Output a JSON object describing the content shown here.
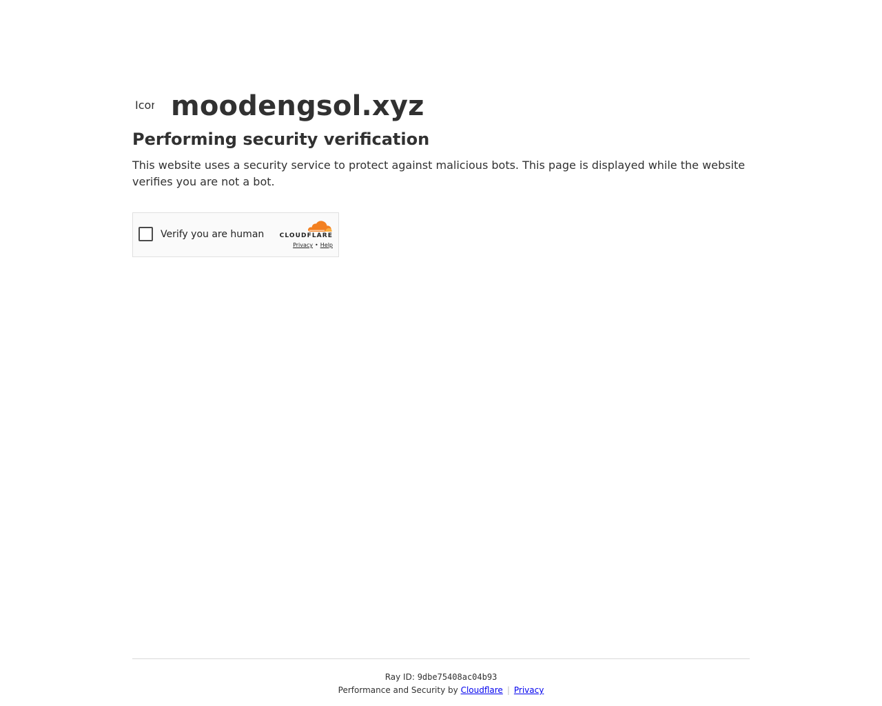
{
  "site": {
    "favicon_alt": "Icon for moodengsol.xyz",
    "name": "moodengsol.xyz"
  },
  "challenge": {
    "heading": "Performing security verification",
    "description": "This website uses a security service to protect against malicious bots. This page is displayed while the website verifies you are not a bot."
  },
  "widget": {
    "checkbox_label": "Verify you are human",
    "brand_wordmark": "CLOUDFLARE",
    "privacy_link": "Privacy",
    "separator": "•",
    "help_link": "Help",
    "colors": {
      "cloud_primary": "#F38020",
      "cloud_secondary": "#FAAE40"
    }
  },
  "footer": {
    "ray_label": "Ray ID:",
    "ray_id": "9dbe75408ac04b93",
    "perf_text": "Performance and Security by",
    "cloudflare_link": "Cloudflare",
    "divider": "|",
    "privacy_link": "Privacy"
  }
}
